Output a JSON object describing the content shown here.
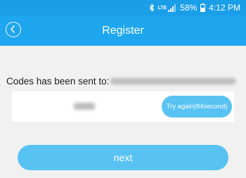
{
  "colors": {
    "status_bar_bg": "#1a9ee8",
    "header_bg": "#1ea6ef",
    "page_bg": "#f1f1f1",
    "button_bg": "#58c2f3",
    "text_on_accent": "#ffffff",
    "body_text": "#1e1e1e"
  },
  "status_bar": {
    "network_label": "LTE",
    "battery_percent": "58%",
    "time": "4:12 PM",
    "icons": [
      "bluetooth-icon",
      "signal-icon",
      "battery-icon"
    ]
  },
  "header": {
    "back_icon": "chevron-left-icon",
    "title": "Register"
  },
  "main": {
    "sent_label": "Codes has been sent to:",
    "retry_button_label": "Try again(84second)",
    "next_button_label": "next"
  }
}
